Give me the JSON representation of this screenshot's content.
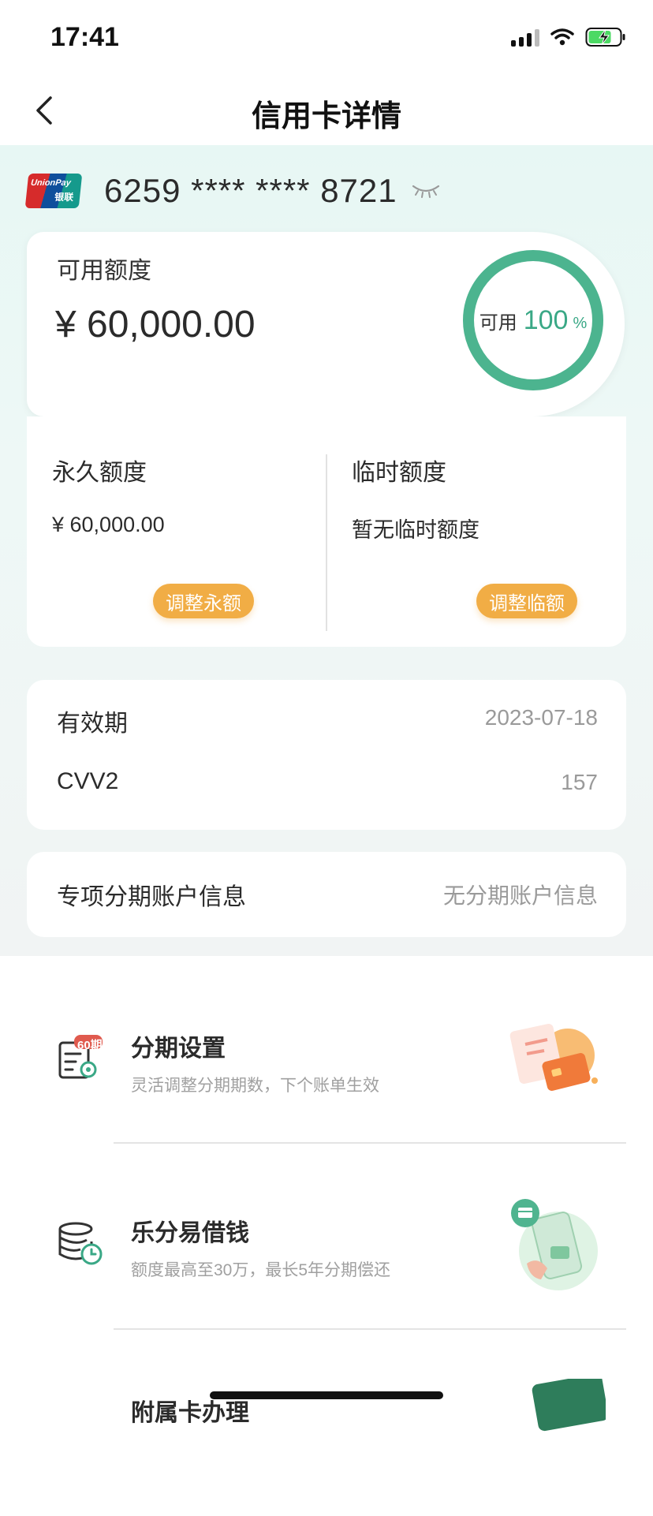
{
  "status_bar": {
    "time": "17:41"
  },
  "header": {
    "title": "信用卡详情"
  },
  "card": {
    "number": "6259 **** **** 8721",
    "brand": "UnionPay",
    "brand_cn": "银联"
  },
  "available_credit": {
    "label": "可用额度",
    "amount": "¥ 60,000.00",
    "ring_label": "可用",
    "ring_percent": "100",
    "ring_unit": "%",
    "percent_value": 100
  },
  "limits": {
    "permanent": {
      "title": "永久额度",
      "value": "¥ 60,000.00",
      "button": "调整永额"
    },
    "temporary": {
      "title": "临时额度",
      "value": "暂无临时额度",
      "button": "调整临额"
    }
  },
  "details": {
    "validity_label": "有效期",
    "validity_value": "2023-07-18",
    "cvv_label": "CVV2",
    "cvv_value": "157"
  },
  "installment_account": {
    "label": "专项分期账户信息",
    "value": "无分期账户信息"
  },
  "services": [
    {
      "title": "分期设置",
      "desc": "灵活调整分期期数，下个账单生效",
      "badge": "60期",
      "icon": "installment-settings-icon"
    },
    {
      "title": "乐分易借钱",
      "desc": "额度最高至30万，最长5年分期偿还",
      "icon": "loan-coins-icon"
    },
    {
      "title": "附属卡办理",
      "icon": "supplementary-card-icon"
    }
  ],
  "colors": {
    "accent_green": "#3aa886",
    "button_orange": "#f1ad45",
    "bg_mint": "#e7f7f4"
  }
}
